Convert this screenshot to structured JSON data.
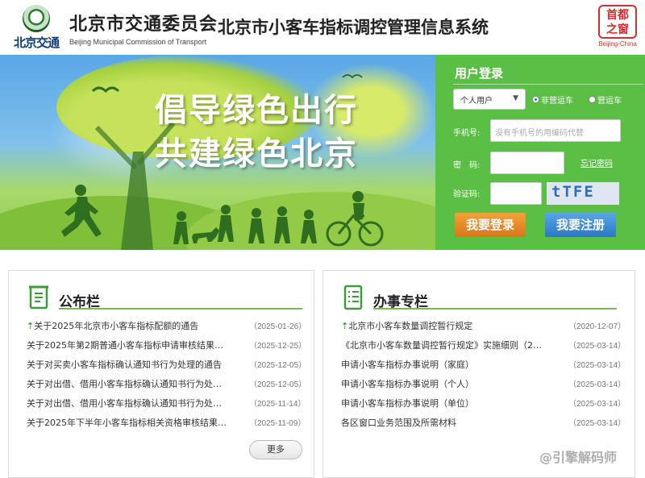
{
  "header": {
    "logo_text": "北京交通",
    "org_cn": "北京市交通委员会",
    "org_en": "Beijing Municipal Commission of Transport",
    "system_title": "北京市小客车指标调控管理信息系统",
    "badge_line1": "首都",
    "badge_line2": "之窗",
    "badge_caption": "Beijing-China"
  },
  "banner": {
    "slogan_line1": "倡导绿色出行",
    "slogan_line2": "共建绿色北京"
  },
  "login": {
    "title": "用户登录",
    "user_type_selected": "个人用户",
    "radio_non_operating": "非营运车",
    "radio_operating": "营运车",
    "phone_label": "手机号:",
    "phone_placeholder": "没有手机号的用编码代替",
    "password_label": "密　码:",
    "password_placeholder": "",
    "forgot_password": "忘记密码",
    "captcha_label": "验证码:",
    "captcha_placeholder": "",
    "captcha_text": "tTFE",
    "login_button": "我要登录",
    "register_button": "我要注册"
  },
  "bulletin": {
    "title": "公布栏",
    "items": [
      {
        "top": true,
        "text": "关于2025年北京市小客车指标配额的通告",
        "date": "（2025-01-26）"
      },
      {
        "top": false,
        "text": "关于2025年第2期普通小客车指标申请审核结果…",
        "date": "（2025-12-25）"
      },
      {
        "top": false,
        "text": "关于对买卖小客车指标确认通知书行为处理的通告",
        "date": "（2025-12-05）"
      },
      {
        "top": false,
        "text": "关于对出借、借用小客车指标确认通知书行为处…",
        "date": "（2025-12-05）"
      },
      {
        "top": false,
        "text": "关于对出借、借用小客车指标确认通知书行为处…",
        "date": "（2025-11-14）"
      },
      {
        "top": false,
        "text": "关于2025年下半年小客车指标相关资格审核结果…",
        "date": "（2025-11-09）"
      }
    ],
    "more_label": "更多"
  },
  "services": {
    "title": "办事专栏",
    "items": [
      {
        "top": true,
        "text": "北京市小客车数量调控暂行规定",
        "date": "（2020-12-07）"
      },
      {
        "top": false,
        "text": "《北京市小客车数量调控暂行规定》实施细则（2…",
        "date": "（2025-03-14）"
      },
      {
        "top": false,
        "text": "申请小客车指标办事说明（家庭）",
        "date": "（2025-03-14）"
      },
      {
        "top": false,
        "text": "申请小客车指标办事说明（个人）",
        "date": "（2025-03-14）"
      },
      {
        "top": false,
        "text": "申请小客车指标办事说明（单位）",
        "date": "（2025-03-14）"
      },
      {
        "top": false,
        "text": "各区窗口业务范围及所需材料",
        "date": "（2025-03-14）"
      }
    ]
  },
  "watermark": "@引擎解码师",
  "colors": {
    "login_panel": "#5bbf45",
    "login_button": "#e38a24",
    "register_button": "#3b8ad6",
    "accent_line": "#6cc04a"
  }
}
